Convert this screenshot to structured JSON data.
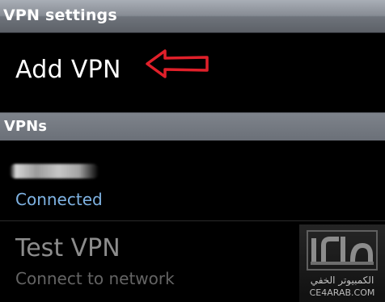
{
  "title_bar": {
    "title": "VPN settings"
  },
  "add_vpn": {
    "label": "Add VPN",
    "annotation_icon": "red-arrow-icon",
    "annotation_color": "#e0202a"
  },
  "section": {
    "header": "VPNs"
  },
  "vpns": [
    {
      "name": "",
      "status": "Connected",
      "status_color": "#7fb3e3",
      "name_redacted": true
    },
    {
      "name": "Test VPN",
      "status": "Connect to network",
      "status_color": "#646464"
    }
  ],
  "watermark": {
    "arabic_text": "الكمبيوتر الخفي",
    "latin_text": "CE4ARAB.COM"
  }
}
